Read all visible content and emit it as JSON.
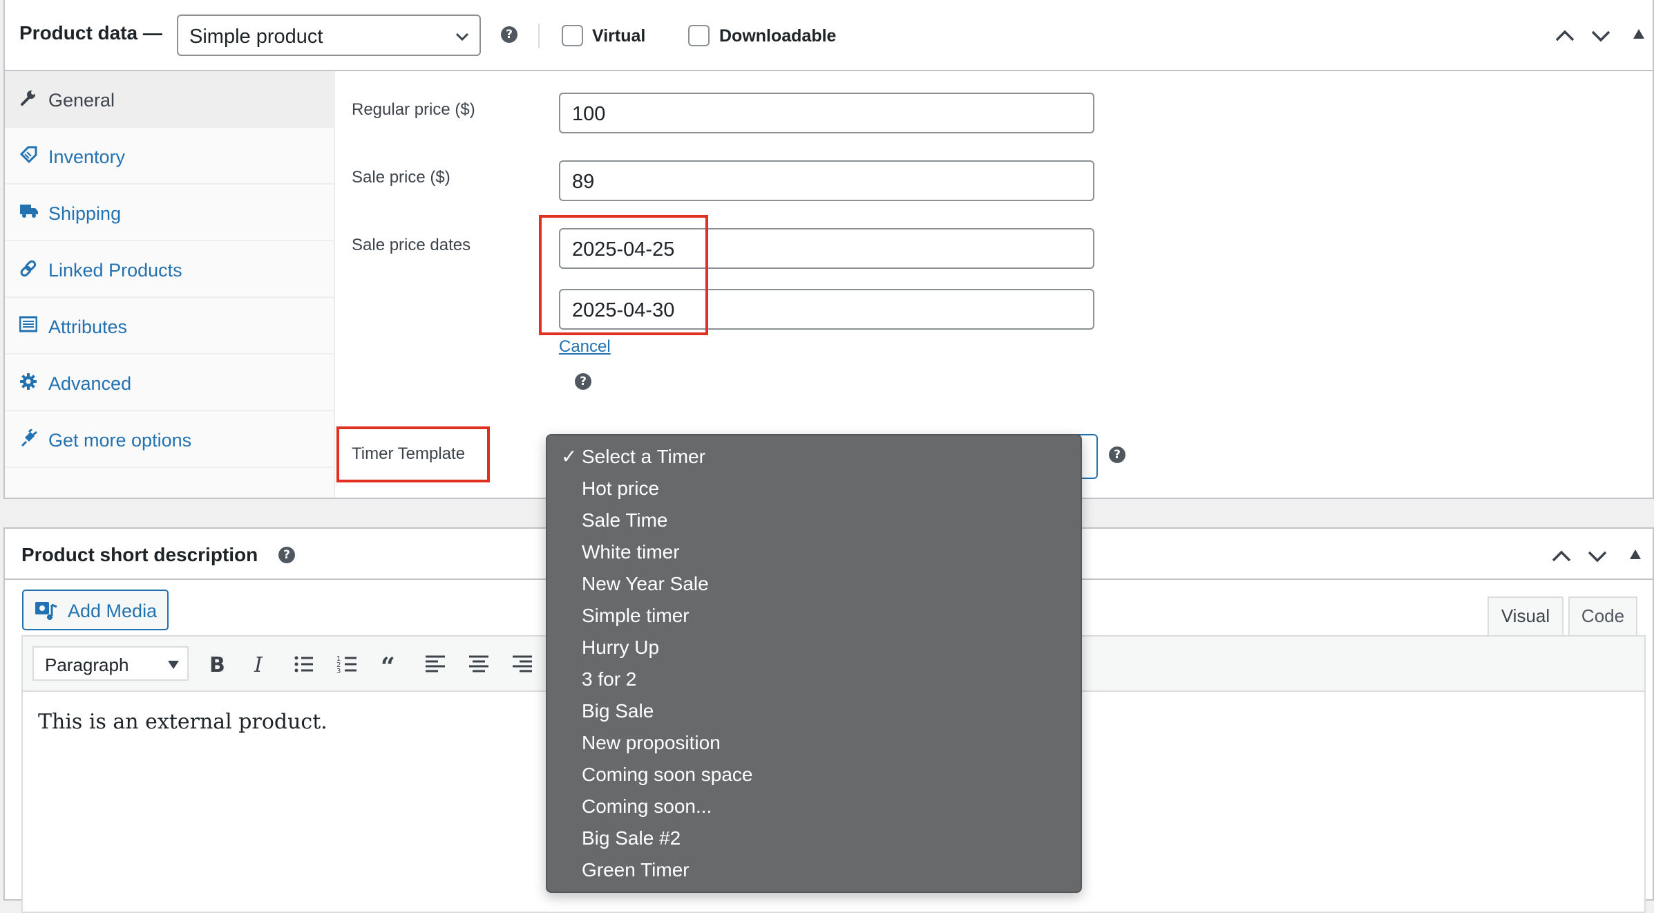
{
  "product_data": {
    "title": "Product data —",
    "type_select": {
      "value": "Simple product"
    },
    "virtual_label": "Virtual",
    "downloadable_label": "Downloadable",
    "tabs": [
      {
        "label": "General",
        "icon": "wrench-icon"
      },
      {
        "label": "Inventory",
        "icon": "tag-icon"
      },
      {
        "label": "Shipping",
        "icon": "truck-icon"
      },
      {
        "label": "Linked Products",
        "icon": "link-icon"
      },
      {
        "label": "Attributes",
        "icon": "list-icon"
      },
      {
        "label": "Advanced",
        "icon": "gear-icon"
      },
      {
        "label": "Get more options",
        "icon": "plugin-icon"
      }
    ],
    "fields": {
      "regular_price": {
        "label": "Regular price ($)",
        "value": "100"
      },
      "sale_price": {
        "label": "Sale price ($)",
        "value": "89"
      },
      "sale_dates": {
        "label": "Sale price dates",
        "from": "2025-04-25",
        "to": "2025-04-30",
        "cancel": "Cancel"
      },
      "timer_template": {
        "label": "Timer Template"
      }
    }
  },
  "timer_options": [
    "Select a Timer",
    "Hot price",
    "Sale Time",
    "White timer",
    "New Year Sale",
    "Simple timer",
    "Hurry Up",
    "3 for 2",
    "Big Sale",
    "New proposition",
    "Coming soon space",
    "Coming soon...",
    "Big Sale #2",
    "Green Timer"
  ],
  "timer_selected": "Select a Timer",
  "short_description": {
    "title": "Product short description",
    "add_media": "Add Media",
    "tab_visual": "Visual",
    "tab_code": "Code",
    "format": "Paragraph",
    "content": "This is an external product."
  },
  "colors": {
    "highlight": "#e1301f",
    "link": "#2271b1",
    "dropdown_bg": "#68696b"
  }
}
